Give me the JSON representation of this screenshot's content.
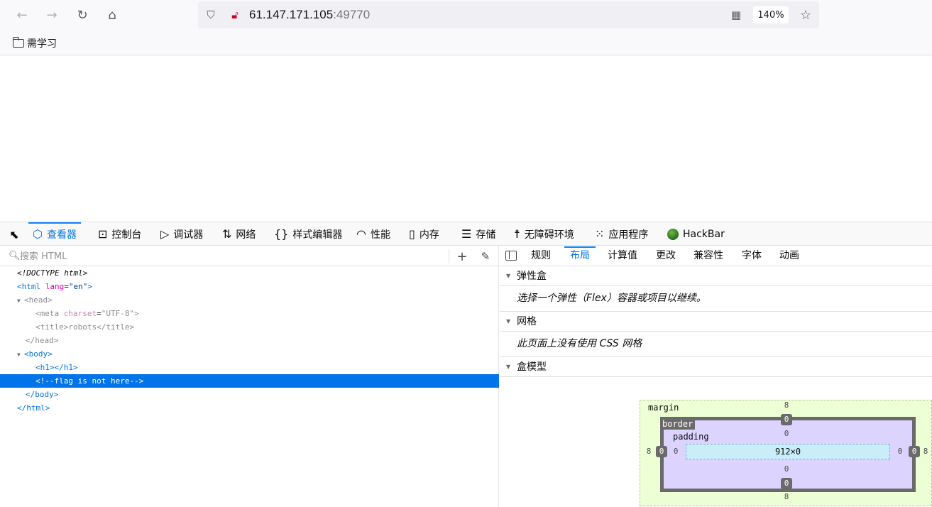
{
  "browser": {
    "url_host": "61.147.171.105",
    "url_port": ":49770",
    "zoom": "140%",
    "bookmark_label": "需学习"
  },
  "devtools": {
    "tabs": [
      {
        "label": "查看器",
        "icon": "inspector-icon"
      },
      {
        "label": "控制台",
        "icon": "console-icon"
      },
      {
        "label": "调试器",
        "icon": "debugger-icon"
      },
      {
        "label": "网络",
        "icon": "network-icon"
      },
      {
        "label": "样式编辑器",
        "icon": "style-editor-icon"
      },
      {
        "label": "性能",
        "icon": "performance-icon"
      },
      {
        "label": "内存",
        "icon": "memory-icon"
      },
      {
        "label": "存储",
        "icon": "storage-icon"
      },
      {
        "label": "无障碍环境",
        "icon": "accessibility-icon"
      },
      {
        "label": "应用程序",
        "icon": "application-icon"
      },
      {
        "label": "HackBar",
        "icon": "hackbar-icon"
      }
    ],
    "search_placeholder": "搜索 HTML",
    "markup": {
      "doctype": "<!DOCTYPE html>",
      "html_open_tag": "<html",
      "html_lang_attr": "lang",
      "html_lang_val": "\"en\"",
      "html_close_bracket": ">",
      "head_open": "<head>",
      "meta_tag": "<meta",
      "meta_attr": "charset",
      "meta_val": "\"UTF-8\"",
      "meta_close": ">",
      "title_open": "<title>",
      "title_text": "robots",
      "title_close": "</title>",
      "head_close": "</head>",
      "body_open": "<body>",
      "h1_line": "<h1></h1>",
      "comment": "<!--flag is not here-->",
      "body_close": "</body>",
      "html_close": "</html>"
    },
    "sidebar_tabs": [
      "规则",
      "布局",
      "计算值",
      "更改",
      "兼容性",
      "字体",
      "动画"
    ],
    "sections": {
      "flex_title": "弹性盒",
      "flex_body": "选择一个弹性（Flex）容器或项目以继续。",
      "grid_title": "网格",
      "grid_body": "此页面上没有使用 CSS 网格",
      "box_title": "盒模型"
    },
    "box_model": {
      "margin_label": "margin",
      "border_label": "border",
      "padding_label": "padding",
      "margin_top": "8",
      "margin_bottom": "8",
      "margin_left": "8",
      "margin_right": "8",
      "border_top": "0",
      "border_bottom": "0",
      "border_left": "0",
      "border_right": "0",
      "padding_top": "0",
      "padding_bottom": "0",
      "padding_left": "0",
      "padding_right": "0",
      "content": "912×0"
    }
  }
}
